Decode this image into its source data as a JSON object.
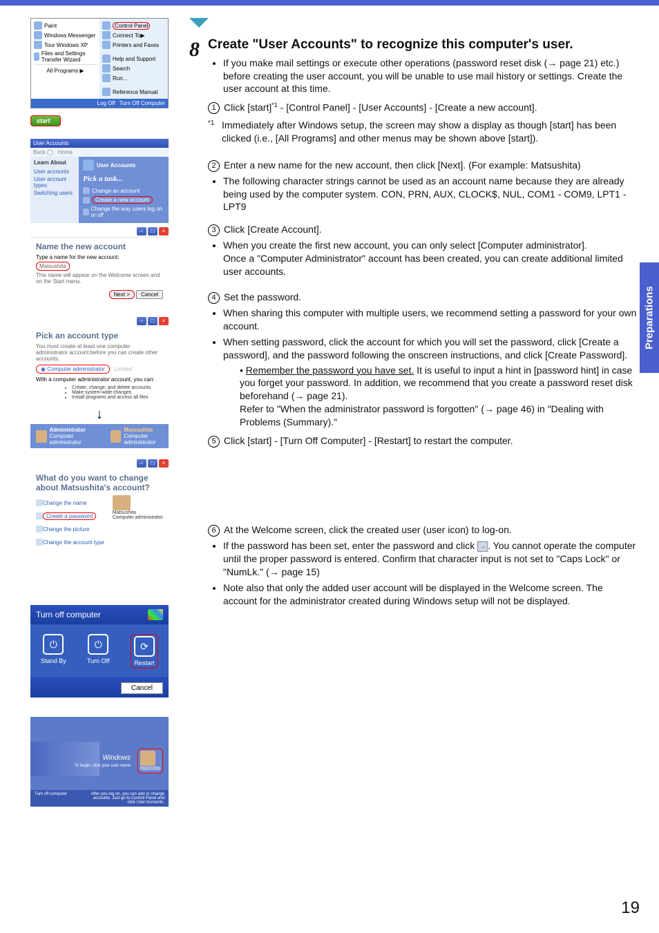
{
  "page_number": "19",
  "side_tab": "Preparations",
  "step": {
    "number": "8",
    "title": "Create \"User Accounts\" to recognize this computer's user."
  },
  "intro_bullet": "If you make mail settings or execute other operations (password reset disk (→ page 21) etc.) before creating the user account, you will be unable to use mail history or settings. Create the user account at this time.",
  "num1": "Click [start]",
  "num1_sup": "*1",
  "num1_rest": " - [Control Panel] - [User Accounts] - [Create a new account].",
  "fn1_mark": "*1",
  "fn1_text": "Immediately after Windows setup, the screen may show a display as though [start] has been clicked (i.e., [All Programs] and other menus may be shown above [start]).",
  "num2": "Enter a new name for the new account, then click [Next]. (For example: Matsushita)",
  "num2_bullet": "The following character strings cannot be used as an account name because they are already being used by the computer system. CON, PRN, AUX, CLOCK$, NUL, COM1 - COM9, LPT1 - LPT9",
  "num3": "Click [Create Account].",
  "num3_bullet_a": "When you create the first new account, you can only select [Computer administrator].",
  "num3_bullet_b": "Once a \"Computer Administrator\" account has been created, you can create additional limited user accounts.",
  "num4": "Set the password.",
  "num4_bullet_a": "When sharing this computer with multiple users, we recommend setting a password for your own account.",
  "num4_bullet_b": "When setting password, click the account for which you will set the password, click [Create a password], and the password following the onscreen instructions, and click [Create Password].",
  "num4_sub": "Remember the password you have set.",
  "num4_sub_rest": " It is useful to input a hint in [password hint] in case you forget your password. In addition, we recommend that you create a password reset disk beforehand (→ page 21).",
  "num4_ref": "Refer to \"When the administrator password is forgotten\" (→ page 46) in \"Dealing with Problems (Summary).\"",
  "num5": "Click [start] - [Turn Off Computer] - [Restart] to restart the computer.",
  "num6": "At the Welcome screen, click the created user (user icon) to log-on.",
  "num6_bullet_a_pre": "If the password has been set, enter the password and click ",
  "num6_bullet_a_post": ". You cannot operate the computer until the proper password is entered. Confirm that character input is not set to \"Caps Lock\" or \"NumLk.\" (→ page 15)",
  "num6_bullet_b": "Note also that only the added user account will be displayed in the Welcome screen. The account for the administrator created during Windows setup will not be displayed.",
  "start_menu": {
    "left": {
      "paint": "Paint",
      "wmsg": "Windows Messenger",
      "tour": "Tour Windows XP",
      "fst": "Files and Settings Transfer Wizard",
      "allprog": "All Programs"
    },
    "right": {
      "cp": "Control Panel",
      "connect": "Connect To",
      "printers": "Printers and Faxes",
      "help": "Help and Support",
      "search": "Search",
      "run": "Run...",
      "refman": "Reference Manual"
    },
    "footer": {
      "logoff": "Log Off",
      "turnoff": "Turn Off Computer"
    },
    "start": "start"
  },
  "ua_window": {
    "title": "User Accounts",
    "back": "Back",
    "home": "Home",
    "learn": "Learn About",
    "l1": "User accounts",
    "l2": "User account types",
    "l3": "Switching users",
    "main_title": "User Accounts",
    "pick": "Pick a task...",
    "t1": "Change an account",
    "t2": "Create a new account",
    "t3": "Change the way users log on or off"
  },
  "name_window": {
    "title": "Name the new account",
    "prompt": "Type a name for the new account:",
    "value": "Matsushita",
    "hint": "This name will appear on the Welcome screen and on the Start menu.",
    "next": "Next >",
    "cancel": "Cancel"
  },
  "pick_window": {
    "title": "Pick an account type",
    "note": "You must create at least one computer administrator account before you can create other accounts.",
    "opt1": "Computer administrator",
    "opt2": "Limited",
    "desc_head": "With a computer administrator account, you can:",
    "d1": "Create, change, and delete accounts",
    "d2": "Make system-wide changes",
    "d3": "Install programs and access all files",
    "admin": "Administrator",
    "admin_sub": "Computer administrator",
    "mat": "Matsushita",
    "mat_sub": "Computer administrator"
  },
  "change_window": {
    "title": "What do you want to change about Matsushita's account?",
    "c1": "Change the name",
    "c2": "Create a password",
    "c3": "Change the picture",
    "c4": "Change the account type",
    "card_name": "Matsushita",
    "card_sub": "Computer administrator"
  },
  "turnoff_dialog": {
    "title": "Turn off computer",
    "standby": "Stand By",
    "turnoff": "Turn Off",
    "restart": "Restart",
    "cancel": "Cancel"
  },
  "welcome": {
    "logo": "Windows",
    "sub": "To begin, click your user name",
    "user": "Matsushita",
    "foot_left": "Turn off computer",
    "foot_right": "After you log on, you can add or change accounts.\nJust go to Control Panel and click User Accounts."
  }
}
